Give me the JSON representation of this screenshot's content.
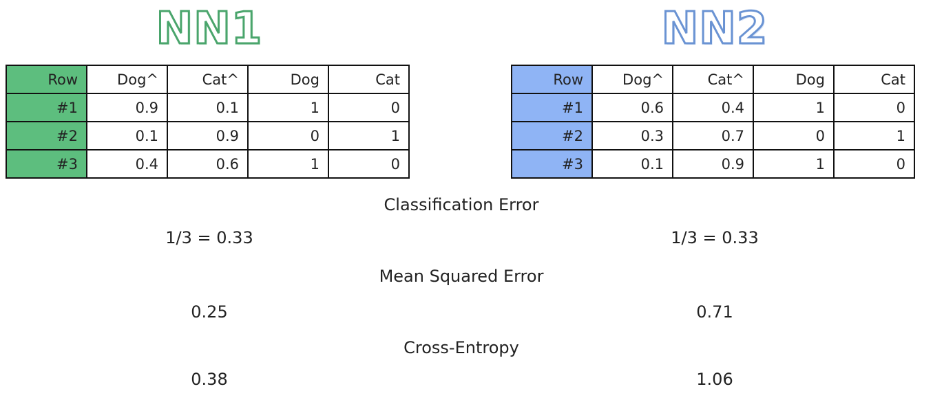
{
  "nn1": {
    "title": "NN1",
    "accent": "#5dbe7e",
    "headers": [
      "Row",
      "Dog^",
      "Cat^",
      "Dog",
      "Cat"
    ],
    "rows": [
      [
        "#1",
        "0.9",
        "0.1",
        "1",
        "0"
      ],
      [
        "#2",
        "0.1",
        "0.9",
        "0",
        "1"
      ],
      [
        "#3",
        "0.4",
        "0.6",
        "1",
        "0"
      ]
    ]
  },
  "nn2": {
    "title": "NN2",
    "accent": "#8fb4f5",
    "headers": [
      "Row",
      "Dog^",
      "Cat^",
      "Dog",
      "Cat"
    ],
    "rows": [
      [
        "#1",
        "0.6",
        "0.4",
        "1",
        "0"
      ],
      [
        "#2",
        "0.3",
        "0.7",
        "0",
        "1"
      ],
      [
        "#3",
        "0.1",
        "0.9",
        "1",
        "0"
      ]
    ]
  },
  "metrics": [
    {
      "title": "Classification Error",
      "nn1": "1/3 = 0.33",
      "nn2": "1/3 = 0.33"
    },
    {
      "title": "Mean Squared Error",
      "nn1": "0.25",
      "nn2": "0.71"
    },
    {
      "title": "Cross-Entropy",
      "nn1": "0.38",
      "nn2": "1.06"
    }
  ]
}
